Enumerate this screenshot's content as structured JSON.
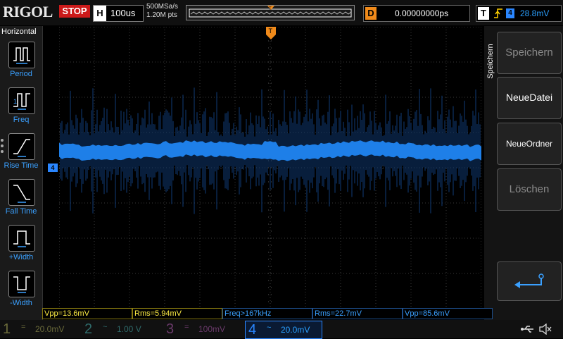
{
  "brand": "RIGOL",
  "run_state": "STOP",
  "horizontal": {
    "label": "H",
    "timebase": "100us",
    "sample_rate": "500MSa/s",
    "memory_depth": "1.20M pts"
  },
  "delay": {
    "label": "D",
    "value": "0.00000000ps"
  },
  "trigger": {
    "label": "T",
    "source": "4",
    "level": "28.8mV",
    "edge": "rising"
  },
  "left_menu": {
    "title": "Horizontal",
    "items": [
      {
        "label": "Period",
        "icon": "period-icon"
      },
      {
        "label": "Freq",
        "icon": "freq-icon"
      },
      {
        "label": "Rise Time",
        "icon": "rise-time-icon"
      },
      {
        "label": "Fall Time",
        "icon": "fall-time-icon"
      },
      {
        "label": "+Width",
        "icon": "positive-width-icon"
      },
      {
        "label": "-Width",
        "icon": "negative-width-icon"
      }
    ]
  },
  "right_menu": {
    "title": "Speichern",
    "buttons": [
      {
        "label": "Speichern",
        "enabled": false
      },
      {
        "label": "NeueDatei",
        "enabled": true
      },
      {
        "label": "NeueOrdner",
        "enabled": true
      },
      {
        "label": "Löschen",
        "enabled": false
      }
    ],
    "return_icon": "return-arrow-icon"
  },
  "measurements": [
    {
      "text": "Vpp=13.6mV",
      "color": "#ffee44"
    },
    {
      "text": "Rms=5.94mV",
      "color": "#ffee44"
    },
    {
      "text": "Freq>167kHz",
      "color": "#3aa0ff"
    },
    {
      "text": "Rms=22.7mV",
      "color": "#3aa0ff"
    },
    {
      "text": "Vpp=85.6mV",
      "color": "#3aa0ff"
    }
  ],
  "channels": [
    {
      "num": "1",
      "coupling": "=",
      "scale": "20.0mV",
      "active": false
    },
    {
      "num": "2",
      "coupling": "~",
      "scale": "1.00 V",
      "active": false
    },
    {
      "num": "3",
      "coupling": "=",
      "scale": "100mV",
      "active": false
    },
    {
      "num": "4",
      "coupling": "~",
      "scale": "20.0mV",
      "active": true
    }
  ],
  "status_icons": [
    "usb-icon",
    "speaker-muted-icon"
  ],
  "colors": {
    "ch4_trace": "#1e7fe8",
    "ch1": "#ffee44",
    "ch2": "#33cccc",
    "ch3": "#cc44cc",
    "ch4": "#2a86ff",
    "delay": "#f08a1a",
    "stop": "#cc1a1a"
  },
  "waveform": {
    "channel": "4",
    "coupling": "AC",
    "description": "noisy band around center with spikes"
  }
}
